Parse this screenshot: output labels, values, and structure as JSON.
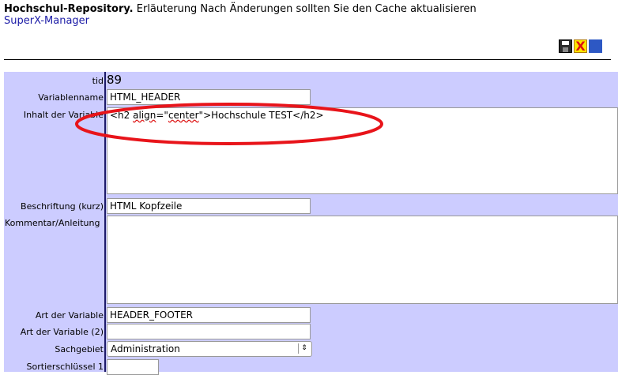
{
  "header": {
    "title_bold": "Hochschul-Repository.",
    "title_rest": " Erläuterung Nach Änderungen sollten Sie den Cache aktualisieren",
    "manager_link": "SuperX-Manager"
  },
  "toolbar": {
    "icons": [
      "save-icon",
      "delete-icon",
      "grid-icon"
    ],
    "delete_glyph": "X"
  },
  "form": {
    "tid_label": "tid",
    "tid_value": "89",
    "variablenname_label": "Variablenname",
    "variablenname_value": "HTML_HEADER",
    "inhalt_label": "Inhalt der Variable",
    "inhalt_value_pre": "<h2 ",
    "inhalt_value_spell1": "align",
    "inhalt_value_mid": "=\"",
    "inhalt_value_spell2": "center",
    "inhalt_value_post": "\">Hochschule TEST</h2>",
    "beschriftung_label": "Beschriftung (kurz)",
    "beschriftung_value": "HTML Kopfzeile",
    "kommentar_label": "Kommentar/Anleitung",
    "kommentar_value": "",
    "art_label": "Art der Variable",
    "art_value": "HEADER_FOOTER",
    "art2_label": "Art der Variable (2)",
    "art2_value": "",
    "sachgebiet_label": "Sachgebiet",
    "sachgebiet_value": "Administration",
    "sortier_label": "Sortierschlüssel 1"
  },
  "annotation": {
    "color": "#e8141a"
  }
}
